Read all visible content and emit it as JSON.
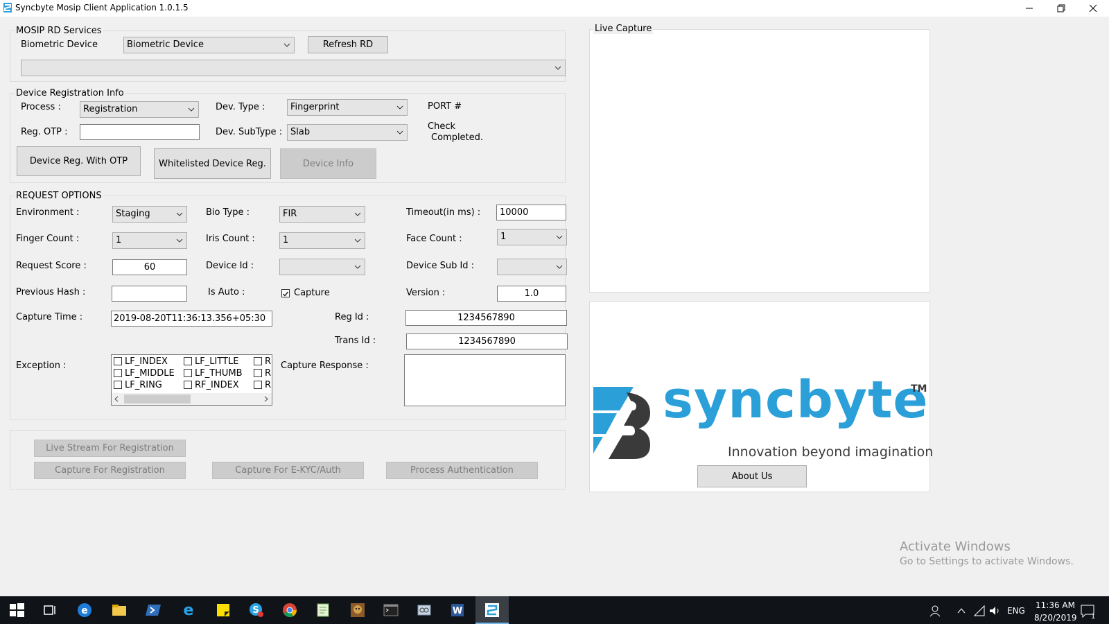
{
  "window": {
    "title": "Syncbyte Mosip Client Application 1.0.1.5",
    "minimize_icon": "minimize-icon",
    "restore_icon": "restore-icon",
    "close_icon": "close-icon"
  },
  "rd_services": {
    "legend": "MOSIP RD Services",
    "biometric_device_label": "Biometric Device",
    "biometric_device_value": "Biometric Device",
    "refresh_button": "Refresh RD",
    "device_list_value": ""
  },
  "device_registration": {
    "legend": "Device Registration Info",
    "process_label": "Process :",
    "process_value": "Registration",
    "dev_type_label": "Dev. Type :",
    "dev_type_value": "Fingerprint",
    "port_label": "PORT #",
    "reg_otp_label": "Reg. OTP :",
    "reg_otp_value": "",
    "dev_subtype_label": "Dev. SubType :",
    "dev_subtype_value": "Slab",
    "status_line1": "Check",
    "status_line2": "Completed.",
    "btn_reg_otp": "Device Reg. With  OTP",
    "btn_whitelisted": "Whitelisted Device Reg.",
    "btn_device_info": "Device Info"
  },
  "request_options": {
    "legend": "REQUEST OPTIONS",
    "environment_label": "Environment :",
    "environment_value": "Staging",
    "bio_type_label": "Bio Type :",
    "bio_type_value": "FIR",
    "timeout_label": "Timeout(in ms)  :",
    "timeout_value": "10000",
    "finger_count_label": "Finger Count :",
    "finger_count_value": "1",
    "iris_count_label": "Iris Count :",
    "iris_count_value": "1",
    "face_count_label": "Face Count  :",
    "face_count_value": "1",
    "request_score_label": "Request Score :",
    "request_score_value": "60",
    "device_id_label": "Device Id :",
    "device_id_value": "",
    "device_sub_id_label": "Device Sub Id  :",
    "device_sub_id_value": "",
    "previous_hash_label": "Previous Hash  :",
    "previous_hash_value": "",
    "is_auto_label": "Is Auto :",
    "capture_checkbox_label": "Capture",
    "capture_checked": true,
    "version_label": "Version  :",
    "version_value": "1.0",
    "capture_time_label": "Capture Time  :",
    "capture_time_value": "2019-08-20T11:36:13.356+05:30",
    "reg_id_label": "Reg Id :",
    "reg_id_value": "1234567890",
    "trans_id_label": "Trans Id :",
    "trans_id_value": "1234567890",
    "exception_label": "Exception :",
    "exceptions_col1": [
      "LF_INDEX",
      "LF_MIDDLE",
      "LF_RING"
    ],
    "exceptions_col2": [
      "LF_LITTLE",
      "LF_THUMB",
      "RF_INDEX"
    ],
    "exceptions_col3": [
      "R",
      "R",
      "R"
    ],
    "capture_response_label": "Capture Response :",
    "capture_response_value": ""
  },
  "actions": {
    "live_stream": "Live Stream For Registration",
    "capture_registration": "Capture For Registration",
    "capture_ekyc": "Capture For E-KYC/Auth",
    "process_auth": "Process Authentication"
  },
  "live_capture": {
    "legend": "Live Capture"
  },
  "branding": {
    "logo_text": "syncbyte",
    "tm": "TM",
    "tagline": "Innovation beyond imagination",
    "about_button": "About Us",
    "brand_color": "#2a9fd8",
    "dark_color": "#3a3a3a"
  },
  "watermark": {
    "line1": "Activate Windows",
    "line2": "Go to Settings to activate Windows."
  },
  "taskbar": {
    "lang": "ENG",
    "time": "11:36 AM",
    "date": "8/20/2019",
    "notification_count": "1",
    "icons": [
      "start-icon",
      "task-view-icon",
      "edge-icon",
      "file-explorer-icon",
      "powershell-icon",
      "internet-explorer-icon",
      "sticky-notes-icon",
      "skype-icon",
      "chrome-icon",
      "notepad-icon",
      "game-icon",
      "terminal-icon",
      "snipping-icon",
      "word-icon",
      "syncbyte-app-icon"
    ]
  }
}
